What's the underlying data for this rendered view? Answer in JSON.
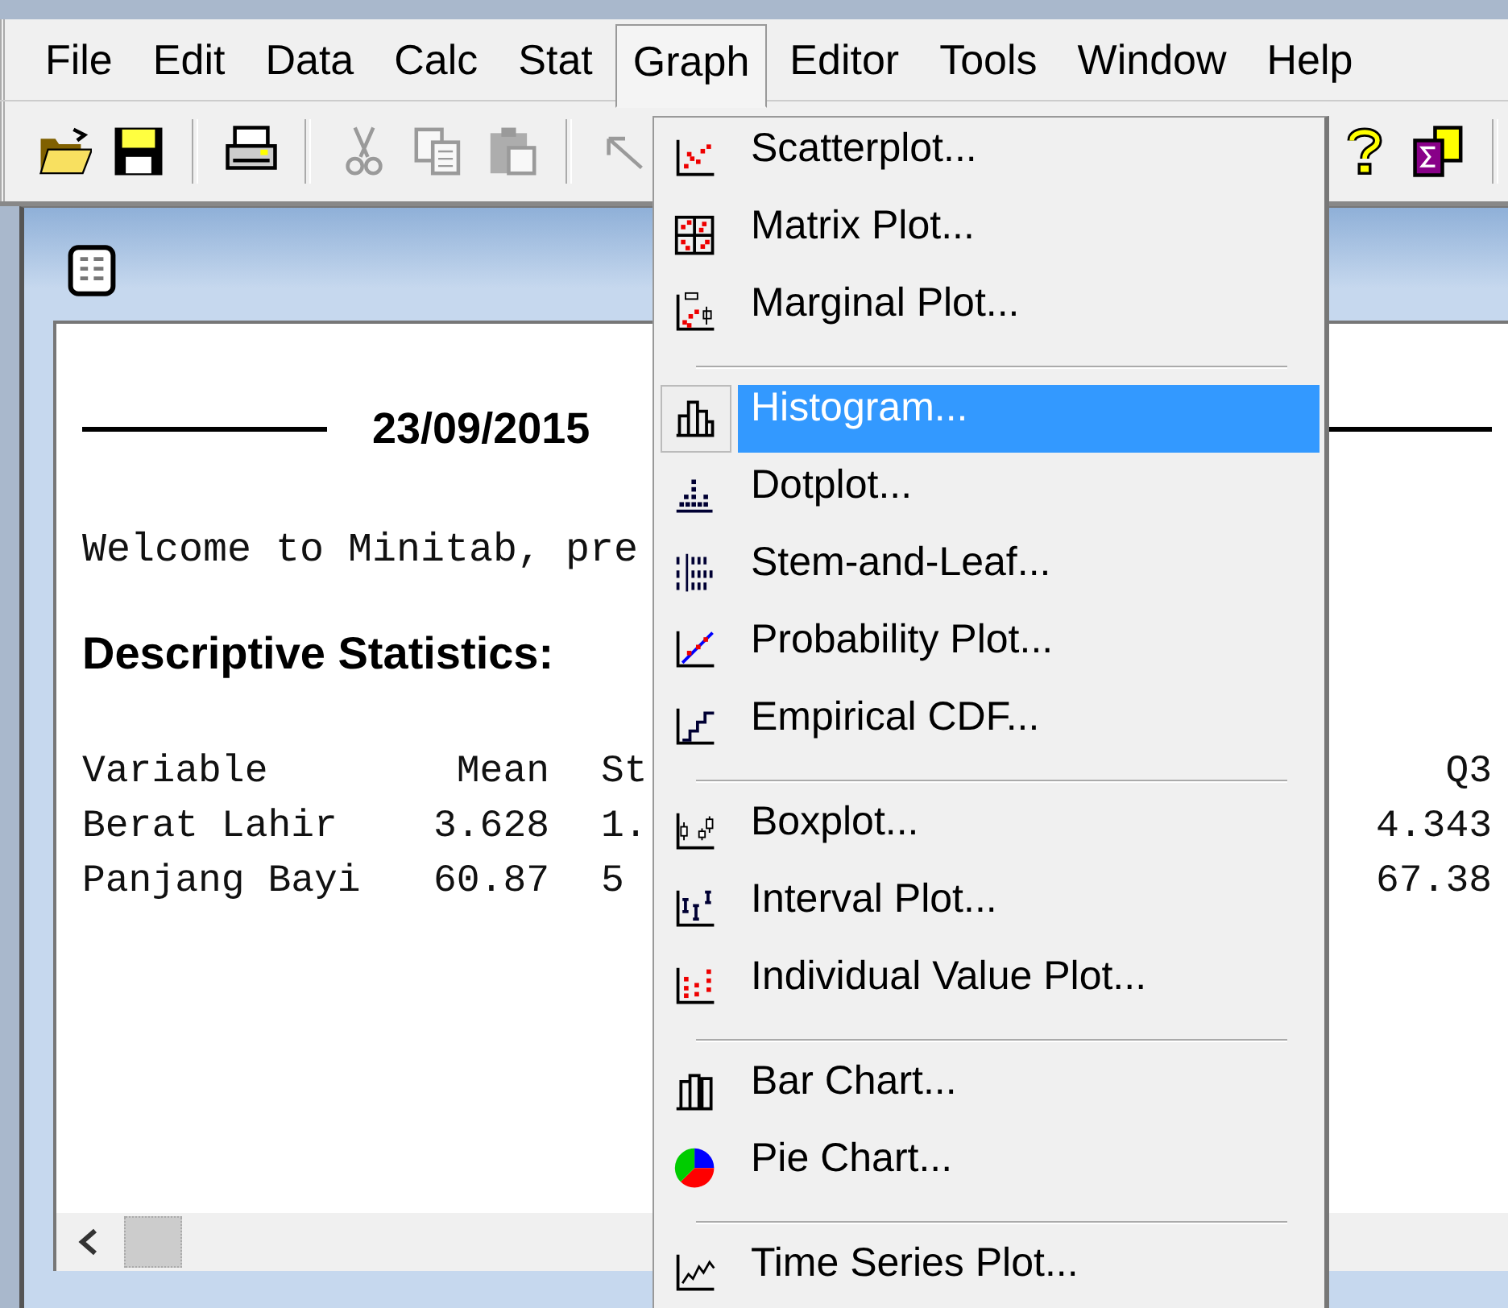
{
  "menu_bar": [
    {
      "label": "File",
      "selected": false
    },
    {
      "label": "Edit",
      "selected": false
    },
    {
      "label": "Data",
      "selected": false
    },
    {
      "label": "Calc",
      "selected": false
    },
    {
      "label": "Stat",
      "selected": false
    },
    {
      "label": "Graph",
      "selected": true
    },
    {
      "label": "Editor",
      "selected": false
    },
    {
      "label": "Tools",
      "selected": false
    },
    {
      "label": "Window",
      "selected": false
    },
    {
      "label": "Help",
      "selected": false
    }
  ],
  "toolbar": [
    {
      "kind": "button",
      "disabled": false
    },
    {
      "kind": "button",
      "disabled": false
    },
    {
      "kind": "separator"
    },
    {
      "kind": "button",
      "disabled": false
    },
    {
      "kind": "separator"
    },
    {
      "kind": "button",
      "disabled": true
    },
    {
      "kind": "button",
      "disabled": true
    },
    {
      "kind": "button",
      "disabled": true
    },
    {
      "kind": "separator"
    },
    {
      "kind": "button",
      "disabled": true
    },
    {
      "kind": "spacer"
    },
    {
      "kind": "button",
      "disabled": false
    },
    {
      "kind": "button",
      "disabled": false
    },
    {
      "kind": "separator"
    }
  ],
  "session": {
    "date_header": "23/09/2015",
    "welcome": "Welcome to Minitab, pre",
    "heading": "Descriptive Statistics:",
    "table": {
      "columns": [
        "Variable",
        "Mean",
        "St",
        "Q3"
      ],
      "rows": [
        [
          "Berat Lahir",
          "3.628",
          "1.",
          "4.343"
        ],
        [
          "Panjang Bayi",
          "60.87",
          "5",
          "67.38"
        ]
      ]
    }
  },
  "graph_menu": {
    "items": [
      {
        "kind": "item",
        "label": "Scatterplot...",
        "selected": false
      },
      {
        "kind": "item",
        "label": "Matrix Plot...",
        "selected": false
      },
      {
        "kind": "item",
        "label": "Marginal Plot...",
        "selected": false
      },
      {
        "kind": "separator"
      },
      {
        "kind": "item",
        "label": "Histogram...",
        "selected": true
      },
      {
        "kind": "item",
        "label": "Dotplot...",
        "selected": false
      },
      {
        "kind": "item",
        "label": "Stem-and-Leaf...",
        "selected": false
      },
      {
        "kind": "item",
        "label": "Probability Plot...",
        "selected": false
      },
      {
        "kind": "item",
        "label": "Empirical CDF...",
        "selected": false
      },
      {
        "kind": "separator"
      },
      {
        "kind": "item",
        "label": "Boxplot...",
        "selected": false
      },
      {
        "kind": "item",
        "label": "Interval Plot...",
        "selected": false
      },
      {
        "kind": "item",
        "label": "Individual Value Plot...",
        "selected": false
      },
      {
        "kind": "separator"
      },
      {
        "kind": "item",
        "label": "Bar Chart...",
        "selected": false
      },
      {
        "kind": "item",
        "label": "Pie Chart...",
        "selected": false
      },
      {
        "kind": "separator"
      },
      {
        "kind": "item",
        "label": "Time Series Plot...",
        "selected": false
      }
    ]
  }
}
